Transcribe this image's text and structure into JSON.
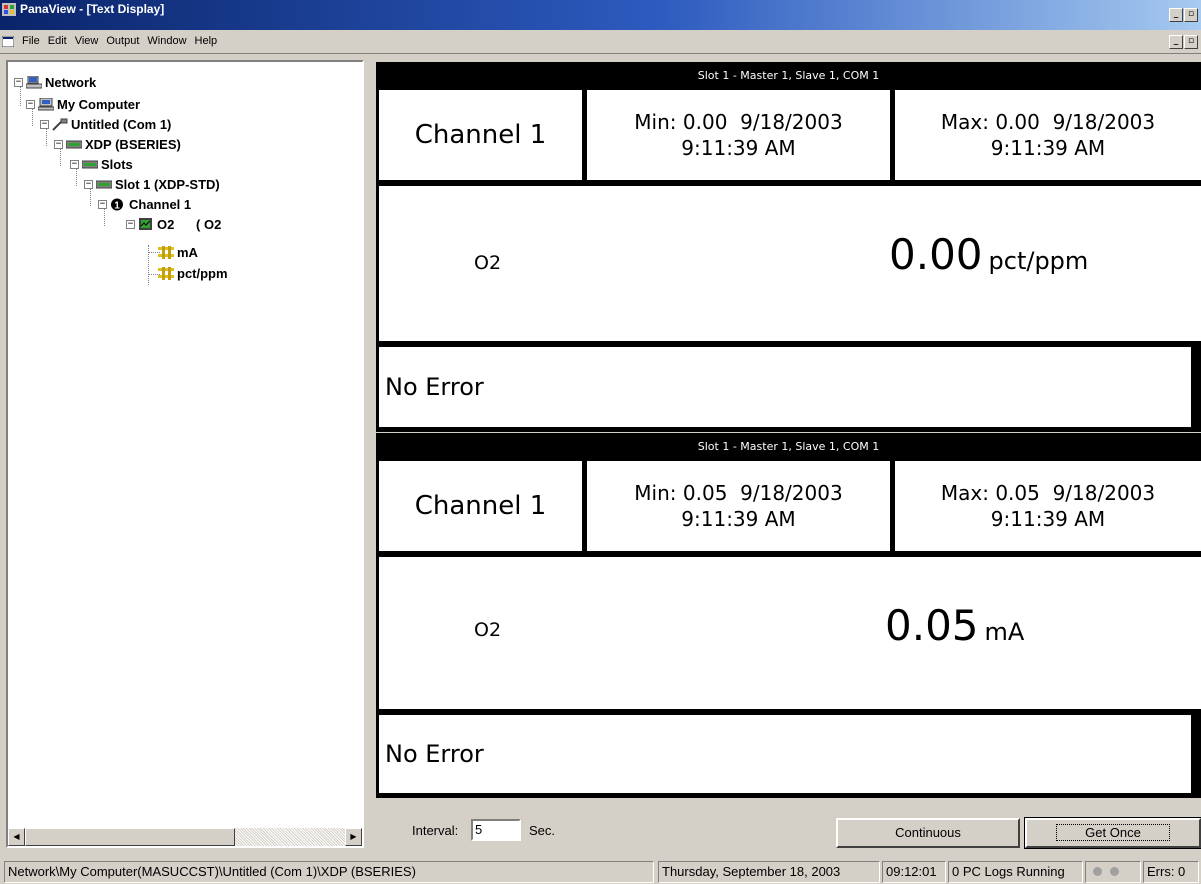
{
  "window": {
    "title": "PanaView - [Text Display]"
  },
  "menu": [
    "File",
    "Edit",
    "View",
    "Output",
    "Window",
    "Help"
  ],
  "tree": {
    "nodes": [
      {
        "label": "Network",
        "icon": "network-icon",
        "expander": "−"
      },
      {
        "label": "My Computer",
        "icon": "computer-icon",
        "expander": "−"
      },
      {
        "label": "Untitled (Com 1)",
        "icon": "cable-icon",
        "expander": "−"
      },
      {
        "label": "XDP (BSERIES)",
        "icon": "device-icon",
        "expander": "−"
      },
      {
        "label": "Slots",
        "icon": "slots-icon",
        "expander": "−"
      },
      {
        "label": "Slot 1 (XDP-STD)",
        "icon": "slot-icon",
        "expander": "−"
      },
      {
        "label": "Channel 1",
        "icon": "channel-number-icon",
        "expander": "−"
      },
      {
        "label": "O2      ( O2",
        "icon": "parameter-icon",
        "expander": "−"
      },
      {
        "label": "mA",
        "icon": "unit-icon",
        "expander": ""
      },
      {
        "label": "pct/ppm",
        "icon": "unit-icon",
        "expander": ""
      }
    ]
  },
  "displays": [
    {
      "header": "Slot 1 - Master 1, Slave 1, COM 1",
      "channel": "Channel 1",
      "min_line1": "Min: 0.00  9/18/2003",
      "min_line2": "9:11:39 AM",
      "max_line1": "Max: 0.00  9/18/2003",
      "max_line2": "9:11:39 AM",
      "parameter": "O2",
      "value": "0.00",
      "unit": "pct/ppm",
      "error": "No Error"
    },
    {
      "header": "Slot 1 - Master 1, Slave 1, COM 1",
      "channel": "Channel 1",
      "min_line1": "Min: 0.05  9/18/2003",
      "min_line2": "9:11:39 AM",
      "max_line1": "Max: 0.05  9/18/2003",
      "max_line2": "9:11:39 AM",
      "parameter": "O2",
      "value": "0.05",
      "unit": "mA",
      "error": "No Error"
    }
  ],
  "controls": {
    "interval_label": "Interval:",
    "interval_value": "5",
    "sec_label": "Sec.",
    "continuous_label": "Continuous",
    "get_once_label": "Get Once"
  },
  "status": {
    "path": "Network\\My Computer(MASUCCST)\\Untitled (Com 1)\\XDP (BSERIES)",
    "date": "Thursday, September 18, 2003",
    "time": "09:12:01",
    "logs": "0 PC Logs Running",
    "errors": "Errs: 0"
  }
}
